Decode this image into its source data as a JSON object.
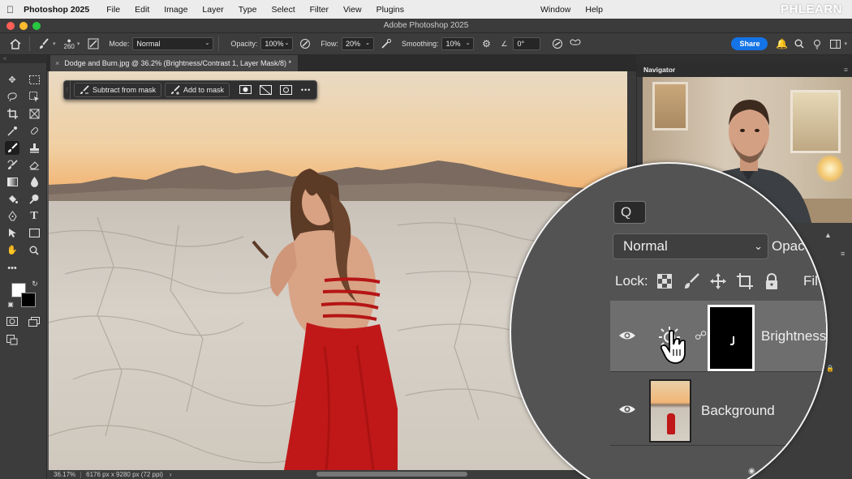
{
  "menubar": {
    "app_name": "Photoshop 2025",
    "items": [
      "File",
      "Edit",
      "Image",
      "Layer",
      "Type",
      "Select",
      "Filter",
      "View",
      "Plugins"
    ],
    "right_items": [
      "Window",
      "Help"
    ],
    "brand": "PHLEARN"
  },
  "window": {
    "title": "Adobe Photoshop 2025"
  },
  "options": {
    "brush_size": "260",
    "mode_label": "Mode:",
    "mode_value": "Normal",
    "opacity_label": "Opacity:",
    "opacity_value": "100%",
    "flow_label": "Flow:",
    "flow_value": "20%",
    "smoothing_label": "Smoothing:",
    "smoothing_value": "10%",
    "angle_value": "0°",
    "share_label": "Share"
  },
  "document": {
    "tab_title": "Dodge and Burn.jpg @ 36.2% (Brightness/Contrast 1, Layer Mask/8) *",
    "zoom": "36.17%",
    "dimensions": "6176 px x 9280 px (72 ppi)"
  },
  "taskbar": {
    "subtract_label": "Subtract from mask",
    "add_label": "Add to mask",
    "more_label": "•••"
  },
  "navigator": {
    "title": "Navigator",
    "menu_glyph": "≡"
  },
  "layers": {
    "search_glyph": "Q",
    "blend_mode": "Normal",
    "opacity_label": "Opac",
    "lock_label": "Lock:",
    "fill_label": "Fil",
    "items": [
      {
        "name": "Brightness",
        "type": "adjustment",
        "selected": true
      },
      {
        "name": "Background",
        "type": "image",
        "selected": false
      }
    ]
  },
  "colors": {
    "share_blue": "#1473e6",
    "panel_bg": "#535353",
    "dress_red": "#c01818"
  }
}
